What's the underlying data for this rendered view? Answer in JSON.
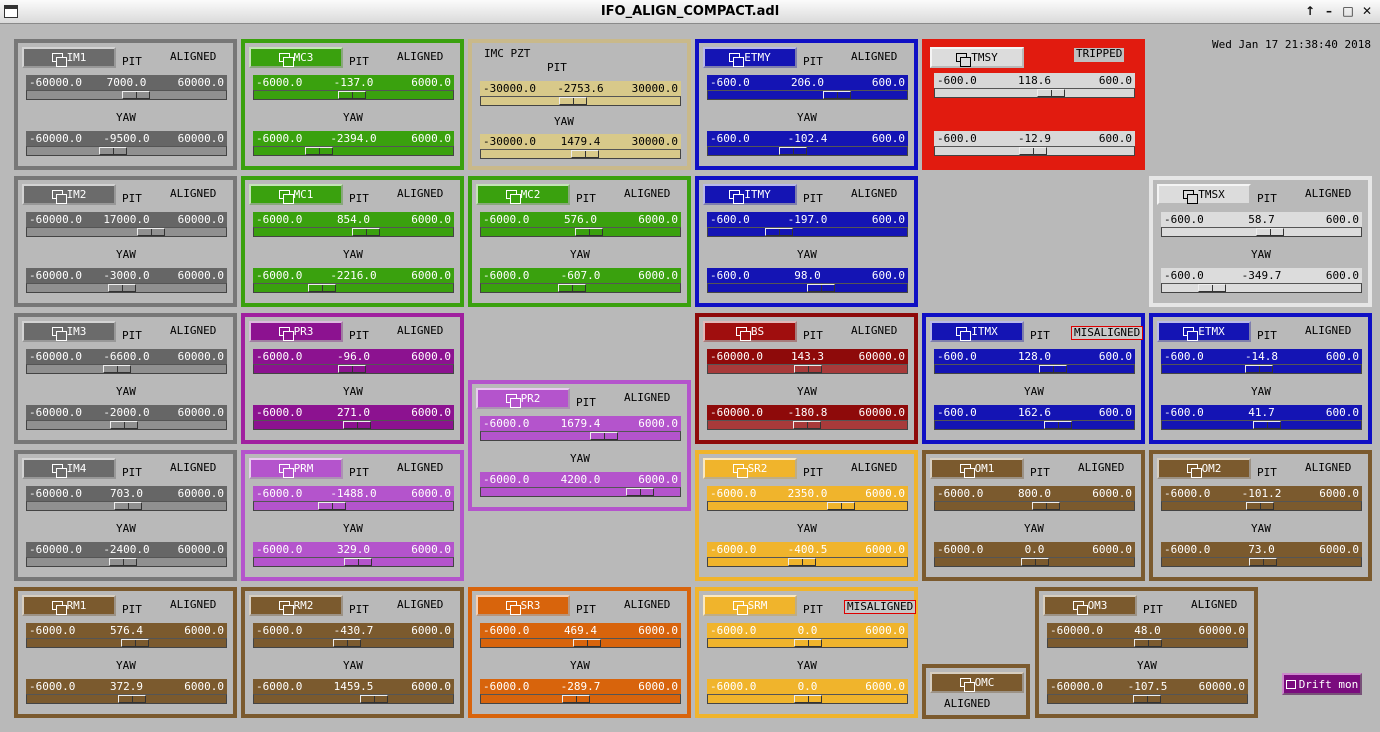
{
  "window": {
    "title": "IFO_ALIGN_COMPACT.adl",
    "buttons": [
      "↑",
      "–",
      "□",
      "✕"
    ]
  },
  "clock": "Wed Jan 17 21:38:40 2018",
  "labels": {
    "pit": "PIT",
    "yaw": "YAW"
  },
  "colors": {
    "gray": "#777777",
    "green": "#3aa10e",
    "tan": "#c9b98a",
    "blue": "#0f0fc4",
    "red": "#e11b0f",
    "purple": "#a0209f",
    "lilac": "#b454cc",
    "darkred": "#8e0a0a",
    "yellow": "#f0b42c",
    "orange": "#d8640c",
    "brown": "#7b5a2e",
    "white": "#e6e6e6"
  },
  "panels": [
    {
      "name": "IM1",
      "status": "ALIGNED",
      "color": "gray",
      "pit": {
        "min": "-60000.0",
        "val": "7000.0",
        "max": "60000.0"
      },
      "yaw": {
        "min": "-60000.0",
        "val": "-9500.0",
        "max": "60000.0"
      }
    },
    {
      "name": "MC3",
      "status": "ALIGNED",
      "color": "green",
      "pit": {
        "min": "-6000.0",
        "val": "-137.0",
        "max": "6000.0"
      },
      "yaw": {
        "min": "-6000.0",
        "val": "-2394.0",
        "max": "6000.0"
      }
    },
    {
      "name": "IMC PZT",
      "status": "",
      "color": "tan",
      "pit": {
        "min": "-30000.0",
        "val": "-2753.6",
        "max": "30000.0"
      },
      "yaw": {
        "min": "-30000.0",
        "val": "1479.4",
        "max": "30000.0"
      }
    },
    {
      "name": "ETMY",
      "status": "ALIGNED",
      "color": "blue",
      "pit": {
        "min": "-600.0",
        "val": "206.0",
        "max": "600.0"
      },
      "yaw": {
        "min": "-600.0",
        "val": "-102.4",
        "max": "600.0"
      }
    },
    {
      "name": "TMSY",
      "status": "TRIPPED",
      "color": "white",
      "pit": {
        "min": "-600.0",
        "val": "118.6",
        "max": "600.0"
      },
      "yaw": {
        "min": "-600.0",
        "val": "-12.9",
        "max": "600.0"
      }
    },
    {
      "name": "IM2",
      "status": "ALIGNED",
      "color": "gray",
      "pit": {
        "min": "-60000.0",
        "val": "17000.0",
        "max": "60000.0"
      },
      "yaw": {
        "min": "-60000.0",
        "val": "-3000.0",
        "max": "60000.0"
      }
    },
    {
      "name": "MC1",
      "status": "ALIGNED",
      "color": "green",
      "pit": {
        "min": "-6000.0",
        "val": "854.0",
        "max": "6000.0"
      },
      "yaw": {
        "min": "-6000.0",
        "val": "-2216.0",
        "max": "6000.0"
      }
    },
    {
      "name": "MC2",
      "status": "ALIGNED",
      "color": "green",
      "pit": {
        "min": "-6000.0",
        "val": "576.0",
        "max": "6000.0"
      },
      "yaw": {
        "min": "-6000.0",
        "val": "-607.0",
        "max": "6000.0"
      }
    },
    {
      "name": "ITMY",
      "status": "ALIGNED",
      "color": "blue",
      "pit": {
        "min": "-600.0",
        "val": "-197.0",
        "max": "600.0"
      },
      "yaw": {
        "min": "-600.0",
        "val": "98.0",
        "max": "600.0"
      }
    },
    {
      "name": "TMSX",
      "status": "ALIGNED",
      "color": "white",
      "pit": {
        "min": "-600.0",
        "val": "58.7",
        "max": "600.0"
      },
      "yaw": {
        "min": "-600.0",
        "val": "-349.7",
        "max": "600.0"
      }
    },
    {
      "name": "IM3",
      "status": "ALIGNED",
      "color": "gray",
      "pit": {
        "min": "-60000.0",
        "val": "-6600.0",
        "max": "60000.0"
      },
      "yaw": {
        "min": "-60000.0",
        "val": "-2000.0",
        "max": "60000.0"
      }
    },
    {
      "name": "PR3",
      "status": "ALIGNED",
      "color": "purple",
      "pit": {
        "min": "-6000.0",
        "val": "-96.0",
        "max": "6000.0"
      },
      "yaw": {
        "min": "-6000.0",
        "val": "271.0",
        "max": "6000.0"
      }
    },
    {
      "name": "PR2",
      "status": "ALIGNED",
      "color": "lilac",
      "pit": {
        "min": "-6000.0",
        "val": "1679.4",
        "max": "6000.0"
      },
      "yaw": {
        "min": "-6000.0",
        "val": "4200.0",
        "max": "6000.0"
      }
    },
    {
      "name": "BS",
      "status": "ALIGNED",
      "color": "darkred",
      "pit": {
        "min": "-60000.0",
        "val": "143.3",
        "max": "60000.0"
      },
      "yaw": {
        "min": "-60000.0",
        "val": "-180.8",
        "max": "60000.0"
      }
    },
    {
      "name": "ITMX",
      "status": "MISALIGNED",
      "color": "blue",
      "pit": {
        "min": "-600.0",
        "val": "128.0",
        "max": "600.0"
      },
      "yaw": {
        "min": "-600.0",
        "val": "162.6",
        "max": "600.0"
      }
    },
    {
      "name": "ETMX",
      "status": "ALIGNED",
      "color": "blue",
      "pit": {
        "min": "-600.0",
        "val": "-14.8",
        "max": "600.0"
      },
      "yaw": {
        "min": "-600.0",
        "val": "41.7",
        "max": "600.0"
      }
    },
    {
      "name": "IM4",
      "status": "ALIGNED",
      "color": "gray",
      "pit": {
        "min": "-60000.0",
        "val": "703.0",
        "max": "60000.0"
      },
      "yaw": {
        "min": "-60000.0",
        "val": "-2400.0",
        "max": "60000.0"
      }
    },
    {
      "name": "PRM",
      "status": "ALIGNED",
      "color": "lilac",
      "pit": {
        "min": "-6000.0",
        "val": "-1488.0",
        "max": "6000.0"
      },
      "yaw": {
        "min": "-6000.0",
        "val": "329.0",
        "max": "6000.0"
      }
    },
    {
      "name": "SR2",
      "status": "ALIGNED",
      "color": "yellow",
      "pit": {
        "min": "-6000.0",
        "val": "2350.0",
        "max": "6000.0"
      },
      "yaw": {
        "min": "-6000.0",
        "val": "-400.5",
        "max": "6000.0"
      }
    },
    {
      "name": "OM1",
      "status": "ALIGNED",
      "color": "brown",
      "pit": {
        "min": "-6000.0",
        "val": "800.0",
        "max": "6000.0"
      },
      "yaw": {
        "min": "-6000.0",
        "val": "0.0",
        "max": "6000.0"
      }
    },
    {
      "name": "OM2",
      "status": "ALIGNED",
      "color": "brown",
      "pit": {
        "min": "-6000.0",
        "val": "-101.2",
        "max": "6000.0"
      },
      "yaw": {
        "min": "-6000.0",
        "val": "73.0",
        "max": "6000.0"
      }
    },
    {
      "name": "RM1",
      "status": "ALIGNED",
      "color": "brown",
      "pit": {
        "min": "-6000.0",
        "val": "576.4",
        "max": "6000.0"
      },
      "yaw": {
        "min": "-6000.0",
        "val": "372.9",
        "max": "6000.0"
      }
    },
    {
      "name": "RM2",
      "status": "ALIGNED",
      "color": "brown",
      "pit": {
        "min": "-6000.0",
        "val": "-430.7",
        "max": "6000.0"
      },
      "yaw": {
        "min": "-6000.0",
        "val": "1459.5",
        "max": "6000.0"
      }
    },
    {
      "name": "SR3",
      "status": "ALIGNED",
      "color": "orange",
      "pit": {
        "min": "-6000.0",
        "val": "469.4",
        "max": "6000.0"
      },
      "yaw": {
        "min": "-6000.0",
        "val": "-289.7",
        "max": "6000.0"
      }
    },
    {
      "name": "SRM",
      "status": "MISALIGNED",
      "color": "yellow",
      "pit": {
        "min": "-6000.0",
        "val": "0.0",
        "max": "6000.0"
      },
      "yaw": {
        "min": "-6000.0",
        "val": "0.0",
        "max": "6000.0"
      }
    },
    {
      "name": "OMC",
      "status": "ALIGNED",
      "color": "brown"
    },
    {
      "name": "OM3",
      "status": "ALIGNED",
      "color": "brown",
      "pit": {
        "min": "-60000.0",
        "val": "48.0",
        "max": "60000.0"
      },
      "yaw": {
        "min": "-60000.0",
        "val": "-107.5",
        "max": "60000.0"
      }
    }
  ],
  "drift_button": "Drift mon"
}
